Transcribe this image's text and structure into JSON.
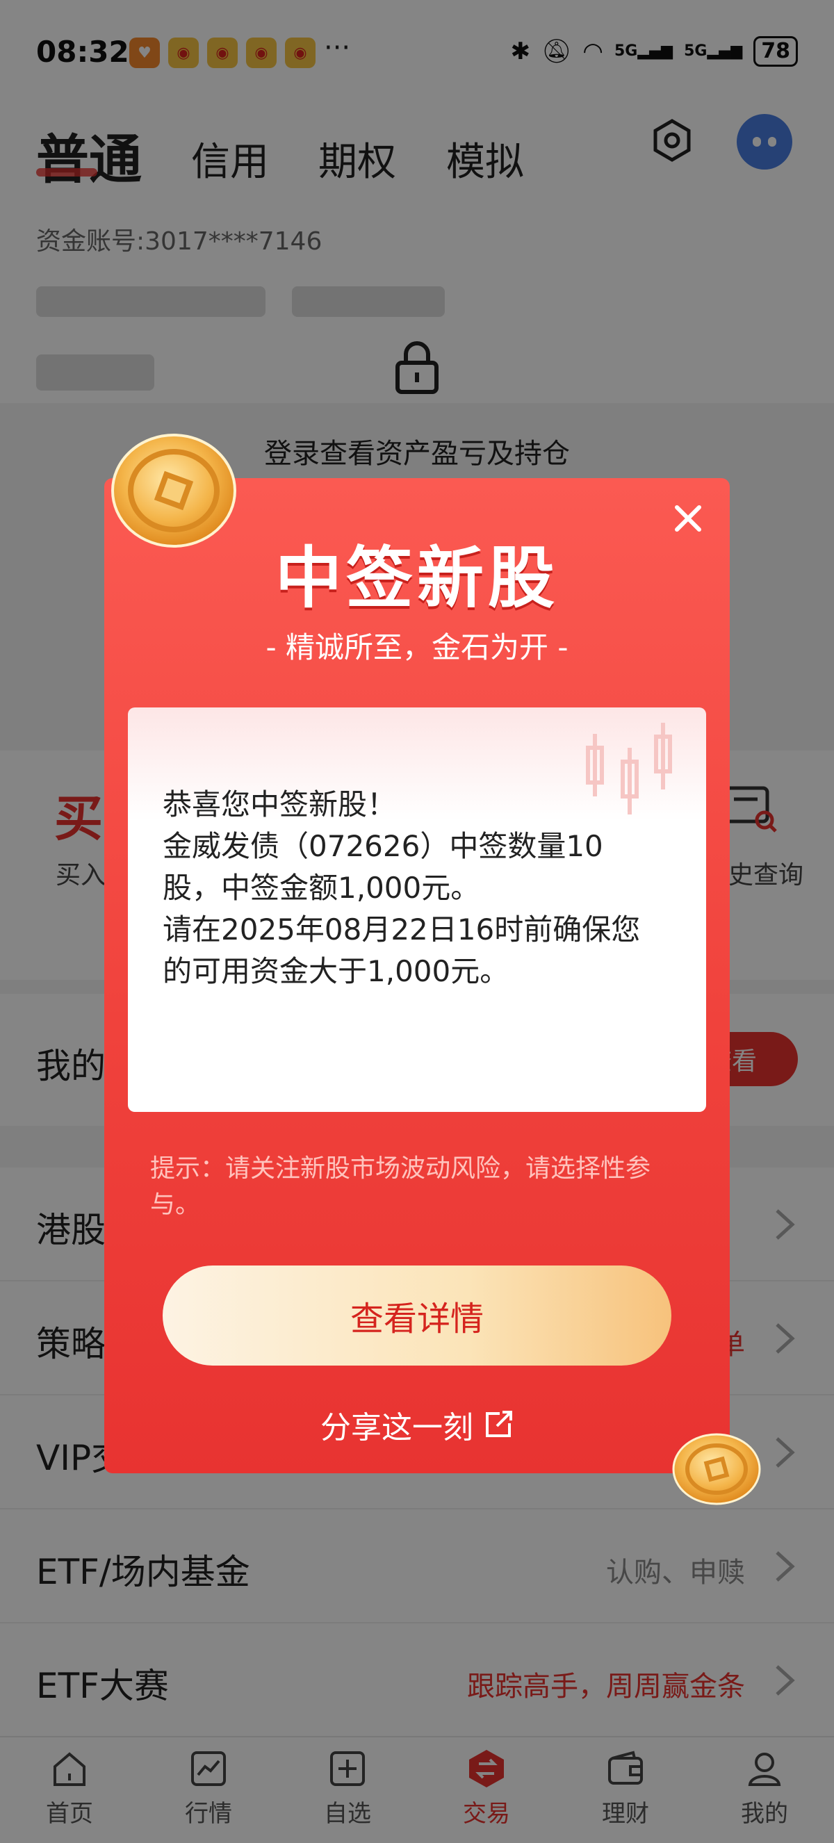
{
  "status_bar": {
    "time": "08:32",
    "more": "···",
    "sig1": "5G",
    "sig2": "5G",
    "battery": "78"
  },
  "header": {
    "tabs": [
      "普通",
      "信用",
      "期权",
      "模拟"
    ],
    "account": "资金账号:3017****7146",
    "login_prompt": "登录查看资产盈亏及持仓"
  },
  "actions": {
    "buy_icon": "买",
    "buy_label": "买入",
    "history_label": "史查询"
  },
  "my_row": {
    "label": "我的",
    "button": "查看"
  },
  "list": [
    {
      "title": "港股",
      "sub": ""
    },
    {
      "title": "策略",
      "sub": "单"
    },
    {
      "title": "VIP交",
      "sub": ""
    },
    {
      "title": "ETF/场内基金",
      "sub": "认购、申赎"
    },
    {
      "title": "ETF大赛",
      "sub": "跟踪高手，周周赢金条"
    }
  ],
  "bottom_nav": [
    "首页",
    "行情",
    "自选",
    "交易",
    "理财",
    "我的"
  ],
  "modal": {
    "title": "中签新股",
    "subtitle": "- 精诚所至，金石为开 -",
    "message": [
      "恭喜您中签新股！",
      "金威发债（072626）中签数量10",
      "股，中签金额1,000元。",
      "请在2025年08月22日16时前确保您",
      "的可用资金大于1,000元。"
    ],
    "tip": "提示：请关注新股市场波动风险，请选择性参与。",
    "detail_button": "查看详情",
    "share": "分享这一刻"
  },
  "colors": {
    "brand_red": "#e8332f",
    "modal_top": "#fb5a52",
    "button_gold": "#f7c27c"
  },
  "icons": [
    "settings-icon",
    "avatar-robot-icon",
    "lock-icon",
    "close-icon",
    "share-icon",
    "chevron-right-icon",
    "home-icon",
    "market-icon",
    "watchlist-icon",
    "trade-icon",
    "wealth-icon",
    "profile-icon",
    "coin-icon"
  ]
}
